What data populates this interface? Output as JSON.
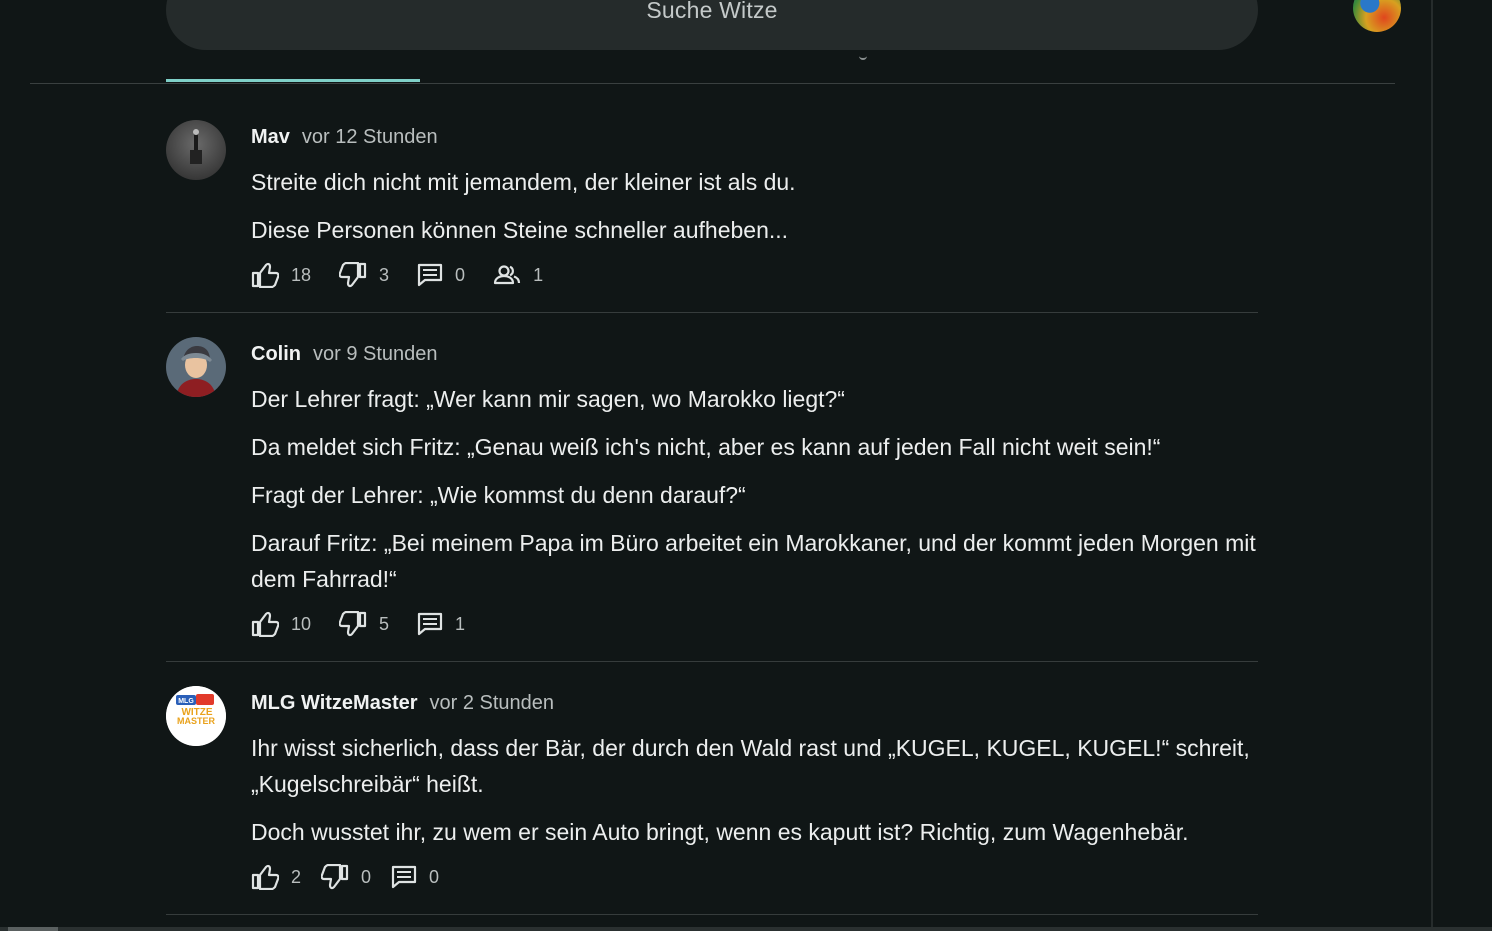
{
  "search": {
    "placeholder": "Suche Witze"
  },
  "posts": [
    {
      "author": "Mav",
      "time": "vor 12 Stunden",
      "lines": [
        "Streite dich nicht mit jemandem, der kleiner ist als du.",
        "Diese Personen können Steine schneller aufheben..."
      ],
      "likes": "18",
      "dislikes": "3",
      "comments": "0",
      "group": "1"
    },
    {
      "author": "Colin",
      "time": "vor 9 Stunden",
      "lines": [
        "Der Lehrer fragt: „Wer kann mir sagen, wo Marokko liegt?“",
        "Da meldet sich Fritz: „Genau weiß ich's nicht, aber es kann auf jeden Fall nicht weit sein!“",
        "Fragt der Lehrer: „Wie kommst du denn darauf?“",
        "Darauf Fritz: „Bei meinem Papa im Büro arbeitet ein Marokkaner, und der kommt jeden Morgen mit dem Fahrrad!“"
      ],
      "likes": "10",
      "dislikes": "5",
      "comments": "1"
    },
    {
      "author": "MLG WitzeMaster",
      "time": "vor 2 Stunden",
      "lines": [
        "Ihr wisst sicherlich, dass der Bär, der durch den Wald rast und „KUGEL, KUGEL, KUGEL!“ schreit, „Kugelschreibär“ heißt.",
        "Doch wusstet ihr, zu wem er sein Auto bringt, wenn es kaputt ist? Richtig, zum Wagenhebär."
      ],
      "likes": "2",
      "dislikes": "0",
      "comments": "0",
      "avatar_logo": {
        "top": "MLG",
        "middle": "WITZE",
        "bottom": "MASTER"
      }
    }
  ],
  "colors": {
    "background": "#101616",
    "accent": "#7fd0c8",
    "search_bg": "#252b2b"
  },
  "icons": [
    "thumbs-up-icon",
    "thumbs-down-icon",
    "comment-icon",
    "group-icon",
    "user-avatar"
  ]
}
